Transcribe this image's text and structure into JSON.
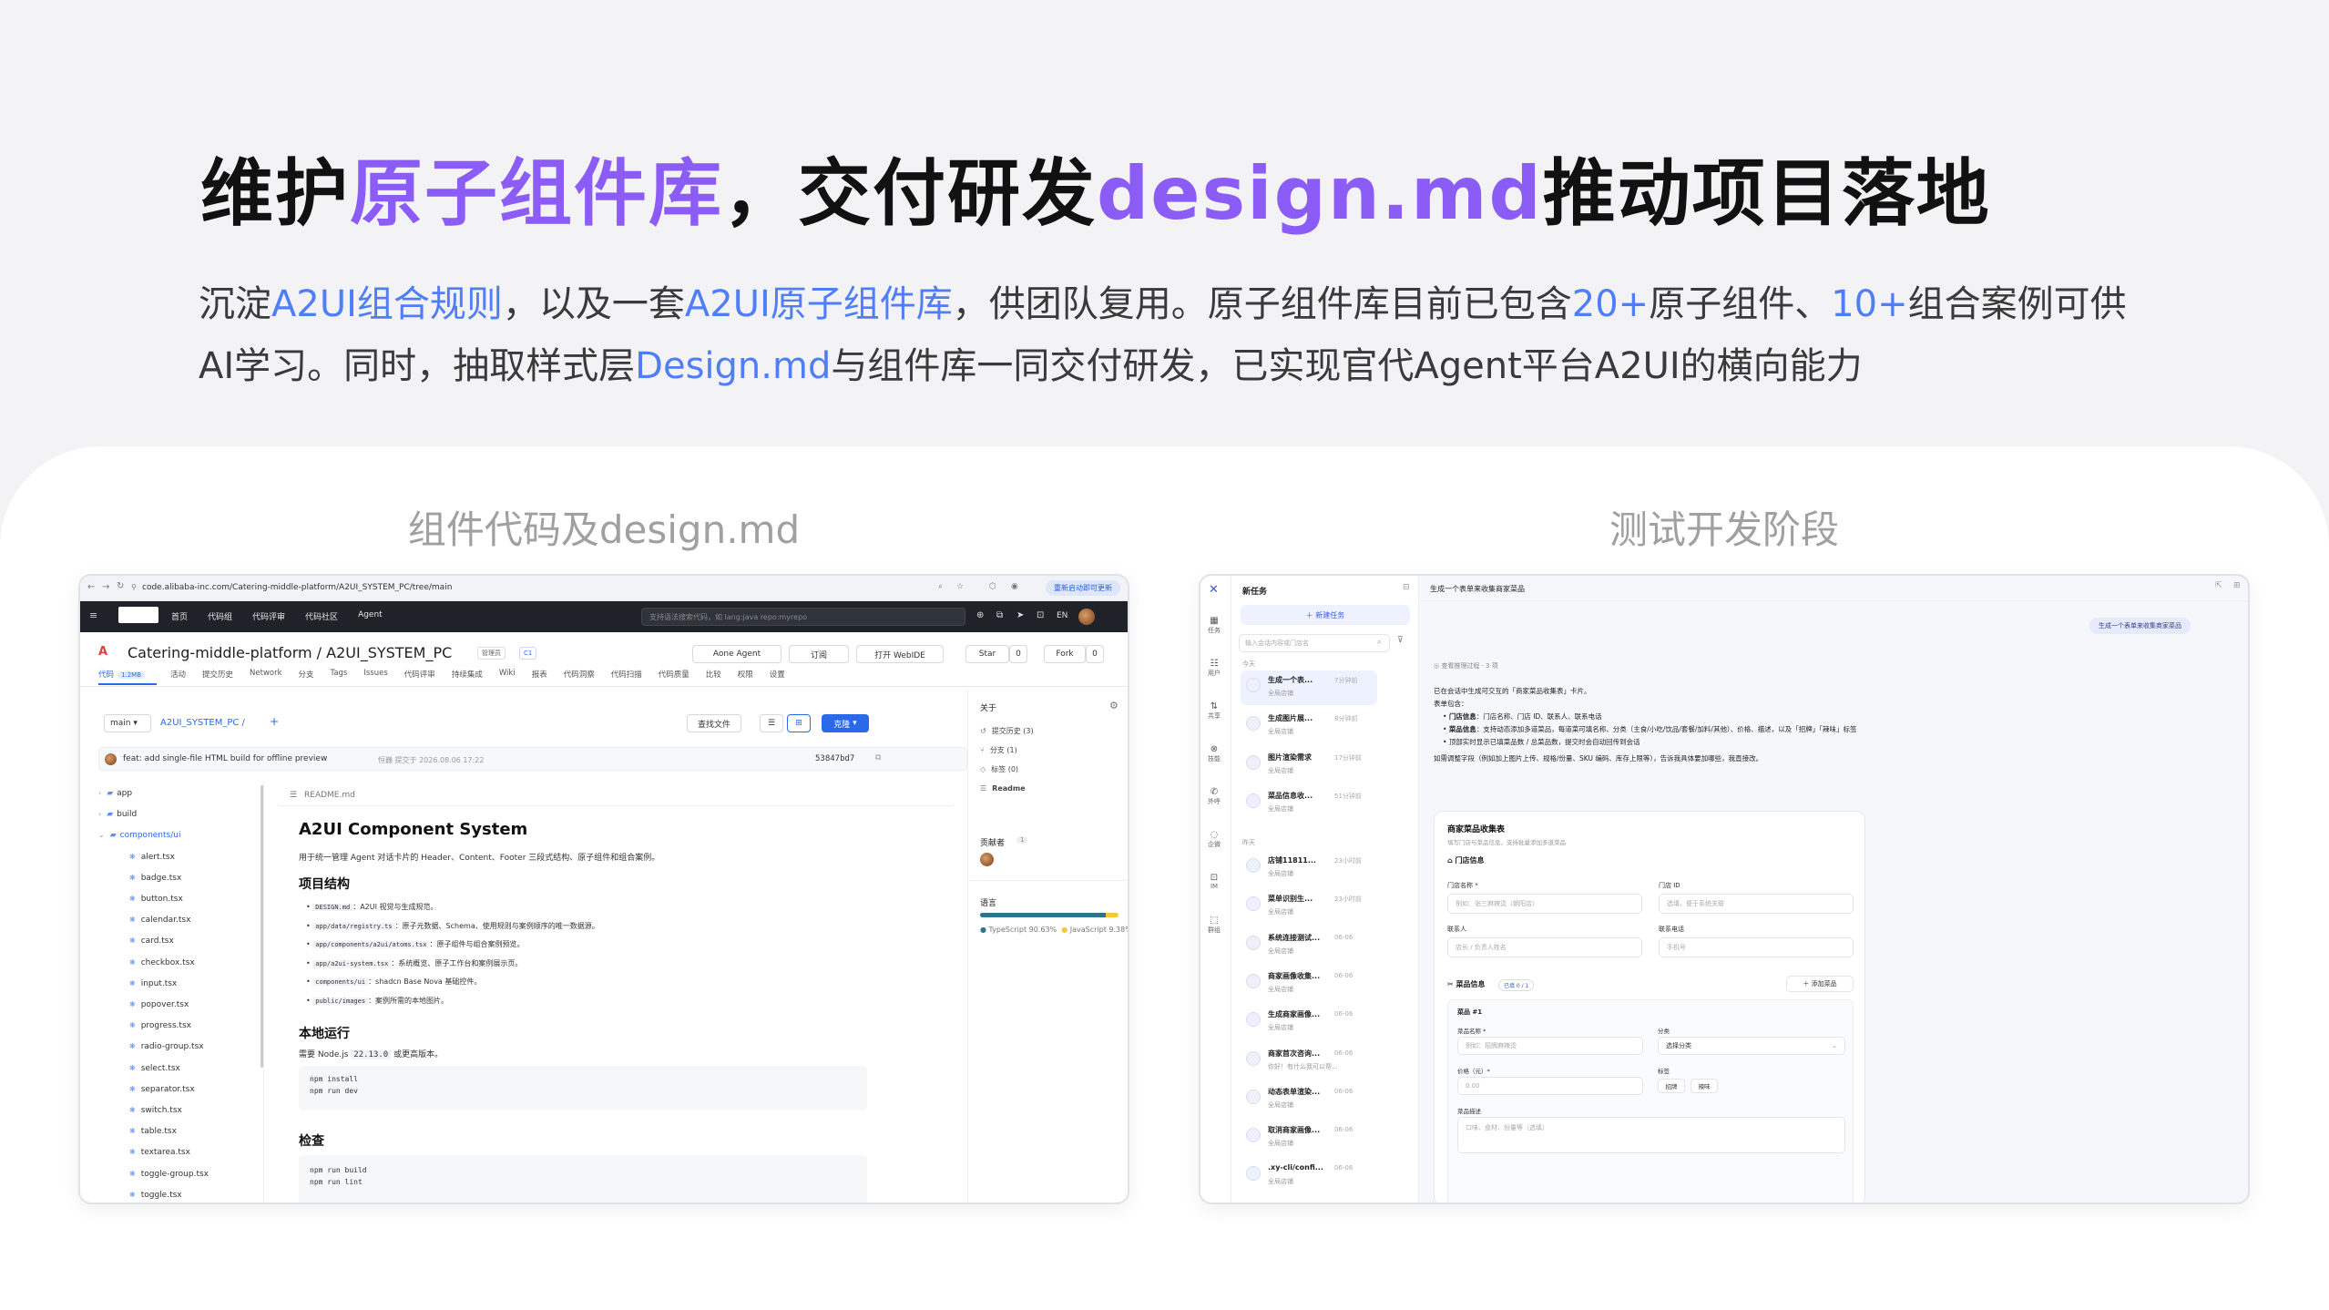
{
  "title": {
    "p1": "维护",
    "p2": "原子组件库",
    "p3": "，交付研发",
    "p4": "design.md",
    "p5": "推动项目落地"
  },
  "description": {
    "d1": "沉淀",
    "d2": "A2UI组合规则",
    "d3": "，以及一套",
    "d4": "A2UI原子组件库",
    "d5": "，供团队复用。原子组件库目前已包含",
    "d6": "20+",
    "d7": "原子组件、",
    "d8": "10+",
    "d9": "组合案例可供AI学习。同时，抽取样式层",
    "d10": "Design.md",
    "d11": "与组件库一同交付研发，已实现官代Agent平台A2UI的横向能力"
  },
  "labels": {
    "left": "组件代码及design.md",
    "right": "测试开发阶段"
  },
  "colors": {
    "highlight": "#8b5cf6",
    "accent_blue": "#4f7ef7"
  },
  "repo": {
    "url": "code.alibaba-inc.com/Catering-middle-platform/A2UI_SYSTEM_PC/tree/main",
    "update_btn": "重新启动即可更新",
    "nav": [
      "首页",
      "代码组",
      "代码评审",
      "代码社区",
      "Agent"
    ],
    "search_placeholder": "支持语法搜索代码，如 lang:java repo:myrepo",
    "lang_btn": "EN",
    "repo_name": "Catering-middle-platform / A2UI_SYSTEM_PC",
    "badge_admin": "管理员",
    "badge_ci": "C1",
    "actions": {
      "agent": "Aone Agent",
      "subscribe": "订阅",
      "webide": "打开 WebIDE",
      "star": "Star",
      "star_count": "0",
      "fork": "Fork",
      "fork_count": "0"
    },
    "tabs": [
      {
        "label": "代码"
      },
      {
        "label": "活动"
      },
      {
        "label": "提交历史"
      },
      {
        "label": "Network"
      },
      {
        "label": "分支"
      },
      {
        "label": "Tags"
      },
      {
        "label": "Issues"
      },
      {
        "label": "代码评审"
      },
      {
        "label": "持续集成"
      },
      {
        "label": "Wiki"
      },
      {
        "label": "报表"
      },
      {
        "label": "代码洞察"
      },
      {
        "label": "代码扫描"
      },
      {
        "label": "代码质量"
      },
      {
        "label": "比较"
      },
      {
        "label": "权限"
      },
      {
        "label": "设置"
      }
    ],
    "code_size": "1.2MB",
    "branch": "main",
    "path": "A2UI_SYSTEM_PC /",
    "find_file": "查找文件",
    "clone": "克隆",
    "commit": {
      "msg": "feat: add single-file HTML build for offline preview",
      "author_time": "恒巍 提交于 2026.08.06 17:22",
      "hash": "53847bd7"
    },
    "tree": [
      "app",
      "build",
      "components/ui",
      "alert.tsx",
      "badge.tsx",
      "button.tsx",
      "calendar.tsx",
      "card.tsx",
      "checkbox.tsx",
      "input.tsx",
      "popover.tsx",
      "progress.tsx",
      "radio-group.tsx",
      "select.tsx",
      "separator.tsx",
      "switch.tsx",
      "table.tsx",
      "textarea.tsx",
      "toggle-group.tsx",
      "toggle.tsx"
    ],
    "readme": {
      "file": "README.md",
      "h1": "A2UI Component System",
      "intro": "用于统一管理 Agent 对话卡片的 Header、Content、Footer 三段式结构、原子组件和组合案例。",
      "h2_structure": "项目结构",
      "items": [
        {
          "code": "DESIGN.md",
          "text": "：A2UI 视觉与生成规范。"
        },
        {
          "code": "app/data/registry.ts",
          "text": "：原子元数据、Schema、使用规则与案例顺序的唯一数据源。"
        },
        {
          "code": "app/components/a2ui/atoms.tsx",
          "text": "：原子组件与组合案例预览。"
        },
        {
          "code": "app/a2ui-system.tsx",
          "text": "：系统概览、原子工作台和案例展示页。"
        },
        {
          "code": "components/ui",
          "text": "：shadcn Base Nova 基础控件。"
        },
        {
          "code": "public/images",
          "text": "：案例所需的本地图片。"
        }
      ],
      "h2_run": "本地运行",
      "node_pre": "需要 Node.js",
      "node_ver": "22.13.0",
      "node_post": "或更高版本。",
      "code1": [
        "npm install",
        "npm run dev"
      ],
      "h2_check": "检查",
      "code2": [
        "npm run build",
        "npm run lint"
      ]
    },
    "about": {
      "title": "关于",
      "rows": [
        "提交历史 (3)",
        "分支 (1)",
        "标签 (0)",
        "Readme"
      ],
      "contributors": "贡献者",
      "contrib_count": "1",
      "lang_title": "语言",
      "ts": "TypeScript 90.63%",
      "js": "JavaScript 9.38%",
      "ts_pct": 90.63
    }
  },
  "chat": {
    "rail": [
      "任务",
      "用户",
      "共享",
      "技能",
      "外呼",
      "企微",
      "IM",
      "群组"
    ],
    "new_task_title": "新任务",
    "new_task_btn": "新建任务",
    "search_placeholder": "输入会话内容或门店名",
    "section_today": "今天",
    "section_earlier": "昨天",
    "tasks": [
      {
        "name": "生成一个表...",
        "time": "7分钟前",
        "sub": "全局店铺"
      },
      {
        "name": "生成图片展...",
        "time": "8分钟前",
        "sub": "全局店铺"
      },
      {
        "name": "图片渲染需求",
        "time": "17分钟前",
        "sub": "全局店铺"
      },
      {
        "name": "菜品信息收...",
        "time": "51分钟前",
        "sub": "全局店铺"
      },
      {
        "name": "店铺11811...",
        "time": "23小时前",
        "sub": "全局店铺"
      },
      {
        "name": "菜单识别生...",
        "time": "23小时前",
        "sub": "全局店铺"
      },
      {
        "name": "系统连接测试...",
        "time": "06-06",
        "sub": "全局店铺"
      },
      {
        "name": "商家画像收集...",
        "time": "06-06",
        "sub": "全局店铺"
      },
      {
        "name": "生成商家画像...",
        "time": "06-06",
        "sub": "全局店铺"
      },
      {
        "name": "商家首次咨询...",
        "time": "06-06",
        "sub": "你好！有什么我可以帮..."
      },
      {
        "name": "动态表单渲染...",
        "time": "06-06",
        "sub": "全局店铺"
      },
      {
        "name": "取消商家画像...",
        "time": "06-06",
        "sub": "全局店铺"
      },
      {
        "name": ".xy-cli/confi...",
        "time": "06-06",
        "sub": "全局店铺"
      }
    ],
    "header_title": "生成一个表单来收集商家菜品",
    "user_msg": "生成一个表单来收集商家菜品",
    "thinking": "查看推理过程 · 3 项",
    "reply_intro": "已在会话中生成可交互的「商家菜品收集表」卡片。",
    "reply_sub": "表单包含：",
    "bullets": [
      {
        "b": "门店信息",
        "t": "：门店名称、门店 ID、联系人、联系电话"
      },
      {
        "b": "菜品信息",
        "t": "：支持动态添加多道菜品，每道菜可填名称、分类（主食/小吃/饮品/套餐/加料/其他）、价格、描述，以及「招牌」「辣味」标签"
      },
      {
        "b": "",
        "t": "顶部实时显示已填菜品数 / 总菜品数，提交时会自动回传到会话"
      }
    ],
    "reply_end": "如需调整字段（例如加上图片上传、规格/份量、SKU 编码、库存上限等），告诉我具体要加哪些，我直接改。",
    "form": {
      "title": "商家菜品收集表",
      "subtitle": "填写门店与菜品信息，支持批量添加多道菜品",
      "store_section": "门店信息",
      "store_name": "门店名称 *",
      "store_name_ph": "例如：张三麻辣烫（朝阳店）",
      "store_id": "门店 ID",
      "store_id_ph": "选填，便于系统关联",
      "contact": "联系人",
      "contact_ph": "店长 / 负责人姓名",
      "phone": "联系电话",
      "phone_ph": "手机号",
      "dish_section": "菜品信息",
      "dish_badge": "已填 0 / 1",
      "add_dish": "添加菜品",
      "dish_no": "菜品 #1",
      "dish_name": "菜品名称 *",
      "dish_name_ph": "例如：招牌麻辣烫",
      "category": "分类",
      "category_ph": "选择分类",
      "price": "价格（元）*",
      "price_ph": "0.00",
      "tags": "标签",
      "tag1": "招牌",
      "tag2": "辣味",
      "desc": "菜品描述",
      "desc_ph": "口味、食材、份量等（选填）"
    }
  }
}
